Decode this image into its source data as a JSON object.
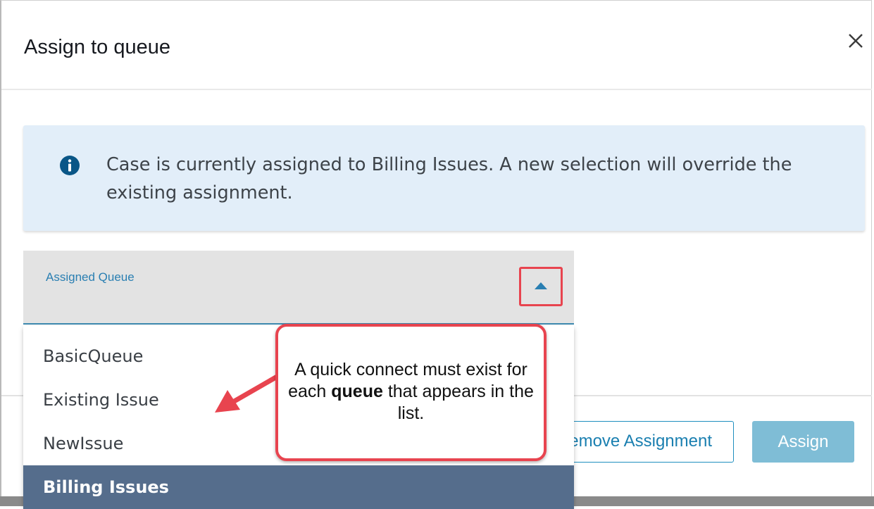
{
  "dialog": {
    "title": "Assign to queue"
  },
  "alert": {
    "message": "Case is currently assigned to Billing Issues. A new selection will override the existing assignment."
  },
  "queue_select": {
    "label": "Assigned Queue",
    "options": [
      {
        "label": "BasicQueue",
        "selected": false
      },
      {
        "label": "Existing Issue",
        "selected": false
      },
      {
        "label": "NewIssue",
        "selected": false
      },
      {
        "label": "Billing Issues",
        "selected": true
      }
    ]
  },
  "callout": {
    "text_before": "A quick connect must exist for each ",
    "text_bold": "queue",
    "text_after": " that appears in the list."
  },
  "footer": {
    "remove_label": "Remove Assignment",
    "assign_label": "Assign"
  },
  "colors": {
    "accent": "#2a7fb2",
    "highlight_red": "#e8444f",
    "selected_bg": "#556d8c",
    "alert_bg": "#e2eef9",
    "assign_disabled": "#7fbdd6"
  },
  "icons": {
    "close": "close-icon",
    "info": "info-icon",
    "caret": "caret-up-icon",
    "arrow": "annotation-arrow"
  }
}
